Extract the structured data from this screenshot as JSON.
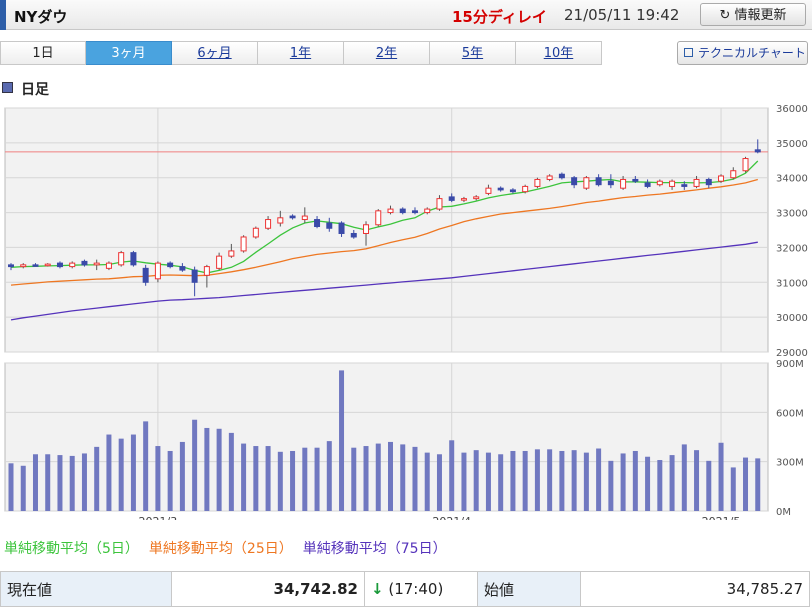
{
  "header": {
    "title": "NYダウ",
    "delay": "15分ディレイ",
    "timestamp": "21/05/11 19:42",
    "refresh_label": "情報更新",
    "refresh_icon": "↻"
  },
  "tabs": [
    "1日",
    "3ヶ月",
    "6ヶ月",
    "1年",
    "2年",
    "5年",
    "10年"
  ],
  "active_tab": 1,
  "technical_button": "テクニカルチャート",
  "section_title": "日足",
  "legend": {
    "ma5": {
      "label": "単純移動平均（5日）",
      "color": "#3cc43c"
    },
    "ma25": {
      "label": "単純移動平均（25日）",
      "color": "#ee7722"
    },
    "ma75": {
      "label": "単純移動平均（75日）",
      "color": "#5533bb"
    }
  },
  "quote": {
    "current_label": "現在値",
    "current_value": "34,742.82",
    "change_arrow": "↓",
    "change_time": "(17:40)",
    "open_label": "始値",
    "open_value": "34,785.27"
  },
  "chart_data": {
    "type": "candlestick",
    "price_ticks": [
      "36000",
      "35000",
      "34000",
      "33000",
      "32000",
      "31000",
      "30000",
      "29000"
    ],
    "price_range": [
      29000,
      36000
    ],
    "volume_ticks": [
      "900M",
      "600M",
      "300M",
      "0M"
    ],
    "volume_range": [
      0,
      900
    ],
    "x_labels": [
      {
        "label": "2021/3",
        "index": 12
      },
      {
        "label": "2021/4",
        "index": 36
      },
      {
        "label": "2021/5",
        "index": 58
      }
    ],
    "reference_line": 34742.82,
    "colors": {
      "up": "#ee3333",
      "down": "#3a4aa8",
      "volume": "#7078c0"
    },
    "candles": [
      [
        31500,
        31550,
        31350,
        31450
      ],
      [
        31450,
        31550,
        31400,
        31500
      ],
      [
        31500,
        31550,
        31450,
        31480
      ],
      [
        31480,
        31550,
        31450,
        31520
      ],
      [
        31550,
        31600,
        31400,
        31450
      ],
      [
        31450,
        31600,
        31400,
        31550
      ],
      [
        31600,
        31650,
        31450,
        31500
      ],
      [
        31500,
        31650,
        31350,
        31550
      ],
      [
        31400,
        31600,
        31350,
        31550
      ],
      [
        31500,
        31900,
        31450,
        31850
      ],
      [
        31850,
        31900,
        31450,
        31500
      ],
      [
        31400,
        31500,
        30900,
        31000
      ],
      [
        31100,
        31600,
        31000,
        31550
      ],
      [
        31550,
        31600,
        31400,
        31450
      ],
      [
        31450,
        31550,
        31300,
        31350
      ],
      [
        31350,
        31450,
        30600,
        31000
      ],
      [
        31200,
        31500,
        30850,
        31450
      ],
      [
        31400,
        31850,
        31350,
        31750
      ],
      [
        31750,
        32100,
        31700,
        31900
      ],
      [
        31900,
        32350,
        31850,
        32300
      ],
      [
        32300,
        32600,
        32250,
        32550
      ],
      [
        32550,
        32900,
        32500,
        32800
      ],
      [
        32700,
        33050,
        32600,
        32850
      ],
      [
        32900,
        32950,
        32800,
        32850
      ],
      [
        32800,
        33150,
        32700,
        32900
      ],
      [
        32800,
        32900,
        32550,
        32600
      ],
      [
        32700,
        32850,
        32450,
        32550
      ],
      [
        32700,
        32750,
        32300,
        32400
      ],
      [
        32400,
        32500,
        32250,
        32300
      ],
      [
        32400,
        32750,
        32050,
        32650
      ],
      [
        32650,
        33100,
        32600,
        33050
      ],
      [
        33000,
        33200,
        32950,
        33100
      ],
      [
        33100,
        33150,
        32950,
        33000
      ],
      [
        33050,
        33150,
        32950,
        33000
      ],
      [
        33000,
        33150,
        32950,
        33100
      ],
      [
        33100,
        33500,
        33050,
        33400
      ],
      [
        33450,
        33550,
        33300,
        33350
      ],
      [
        33400,
        33450,
        33300,
        33400
      ],
      [
        33400,
        33500,
        33350,
        33450
      ],
      [
        33550,
        33800,
        33500,
        33700
      ],
      [
        33700,
        33750,
        33600,
        33650
      ],
      [
        33650,
        33700,
        33550,
        33600
      ],
      [
        33600,
        33800,
        33550,
        33750
      ],
      [
        33750,
        34000,
        33700,
        33950
      ],
      [
        33950,
        34100,
        33900,
        34050
      ],
      [
        34100,
        34150,
        33950,
        34000
      ],
      [
        34000,
        34050,
        33700,
        33800
      ],
      [
        33700,
        34050,
        33650,
        34000
      ],
      [
        34000,
        34100,
        33750,
        33800
      ],
      [
        33900,
        34100,
        33700,
        33800
      ],
      [
        33700,
        34050,
        33650,
        33950
      ],
      [
        33950,
        34050,
        33850,
        33900
      ],
      [
        33850,
        33950,
        33700,
        33750
      ],
      [
        33800,
        33950,
        33750,
        33900
      ],
      [
        33750,
        33950,
        33650,
        33900
      ],
      [
        33800,
        33900,
        33650,
        33750
      ],
      [
        33750,
        34050,
        33700,
        33950
      ],
      [
        33950,
        34000,
        33700,
        33800
      ],
      [
        33900,
        34100,
        33850,
        34050
      ],
      [
        34000,
        34300,
        33950,
        34200
      ],
      [
        34200,
        34600,
        34150,
        34550
      ],
      [
        34800,
        35100,
        34700,
        34742
      ]
    ],
    "volumes": [
      290,
      275,
      345,
      345,
      340,
      335,
      350,
      390,
      465,
      440,
      465,
      545,
      395,
      365,
      420,
      555,
      505,
      500,
      475,
      410,
      395,
      395,
      360,
      365,
      385,
      385,
      425,
      855,
      385,
      395,
      410,
      420,
      405,
      390,
      355,
      345,
      430,
      355,
      370,
      355,
      345,
      365,
      365,
      375,
      375,
      365,
      370,
      355,
      380,
      305,
      350,
      365,
      330,
      310,
      340,
      405,
      370,
      305,
      415,
      265,
      325,
      320
    ],
    "ma5": [
      31430,
      31450,
      31460,
      31470,
      31480,
      31490,
      31500,
      31500,
      31510,
      31580,
      31610,
      31560,
      31520,
      31490,
      31440,
      31340,
      31270,
      31340,
      31430,
      31600,
      31860,
      32100,
      32350,
      32560,
      32700,
      32760,
      32720,
      32680,
      32580,
      32500,
      32590,
      32670,
      32780,
      32850,
      33040,
      33160,
      33180,
      33250,
      33330,
      33420,
      33490,
      33540,
      33590,
      33670,
      33750,
      33850,
      33880,
      33900,
      33930,
      33950,
      33880,
      33880,
      33870,
      33860,
      33860,
      33860,
      33850,
      33860,
      33890,
      33960,
      34130,
      34480
    ],
    "ma25": [
      30920,
      30950,
      30980,
      31010,
      31030,
      31050,
      31070,
      31090,
      31100,
      31130,
      31160,
      31170,
      31200,
      31210,
      31200,
      31190,
      31200,
      31250,
      31300,
      31360,
      31430,
      31510,
      31590,
      31680,
      31740,
      31800,
      31840,
      31880,
      31910,
      31960,
      32050,
      32140,
      32220,
      32290,
      32400,
      32530,
      32630,
      32740,
      32820,
      32890,
      32960,
      33000,
      33040,
      33080,
      33120,
      33170,
      33230,
      33290,
      33330,
      33380,
      33430,
      33460,
      33500,
      33530,
      33570,
      33610,
      33650,
      33700,
      33740,
      33790,
      33850,
      33950
    ],
    "ma75": [
      29920,
      29980,
      30030,
      30080,
      30130,
      30180,
      30220,
      30260,
      30300,
      30340,
      30380,
      30420,
      30460,
      30490,
      30500,
      30520,
      30540,
      30560,
      30590,
      30620,
      30650,
      30680,
      30710,
      30740,
      30770,
      30800,
      30830,
      30860,
      30890,
      30920,
      30950,
      30980,
      31010,
      31040,
      31070,
      31100,
      31130,
      31170,
      31210,
      31250,
      31290,
      31330,
      31370,
      31410,
      31450,
      31490,
      31530,
      31570,
      31610,
      31650,
      31690,
      31730,
      31770,
      31810,
      31850,
      31890,
      31930,
      31970,
      32010,
      32050,
      32090,
      32150
    ]
  }
}
